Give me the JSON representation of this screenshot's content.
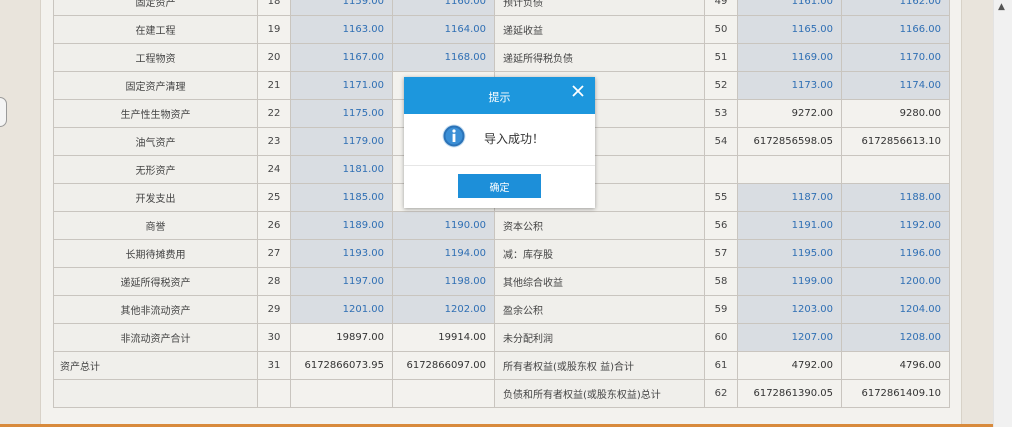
{
  "balance_sheet": {
    "rows": [
      {
        "asset": "固定资产",
        "asset_line": "18",
        "asset_end": "1159.00",
        "asset_begin": "1160.00",
        "liab": "预计负债",
        "liab_line": "49",
        "liab_end": "1161.00",
        "liab_begin": "1162.00"
      },
      {
        "asset": "在建工程",
        "asset_line": "19",
        "asset_end": "1163.00",
        "asset_begin": "1164.00",
        "liab": "递延收益",
        "liab_line": "50",
        "liab_end": "1165.00",
        "liab_begin": "1166.00"
      },
      {
        "asset": "工程物资",
        "asset_line": "20",
        "asset_end": "1167.00",
        "asset_begin": "1168.00",
        "liab": "递延所得税负债",
        "liab_line": "51",
        "liab_end": "1169.00",
        "liab_begin": "1170.00"
      },
      {
        "asset": "固定资产清理",
        "asset_line": "21",
        "asset_end": "1171.00",
        "asset_begin": "",
        "liab": "",
        "liab_line": "52",
        "liab_end": "1173.00",
        "liab_begin": "1174.00"
      },
      {
        "asset": "生产性生物资产",
        "asset_line": "22",
        "asset_end": "1175.00",
        "asset_begin": "",
        "liab": "",
        "liab_line": "53",
        "liab_end": "9272.00",
        "liab_begin": "9280.00"
      },
      {
        "asset": "油气资产",
        "asset_line": "23",
        "asset_end": "1179.00",
        "asset_begin": "",
        "liab": "",
        "liab_line": "54",
        "liab_end": "6172856598.05",
        "liab_begin": "6172856613.10"
      },
      {
        "asset": "无形资产",
        "asset_line": "24",
        "asset_end": "1181.00",
        "asset_begin": "",
        "liab": "东权益）：",
        "liab_line": "",
        "liab_end": "",
        "liab_begin": ""
      },
      {
        "asset": "开发支出",
        "asset_line": "25",
        "asset_end": "1185.00",
        "asset_begin": "",
        "liab": "",
        "liab_line": "55",
        "liab_end": "1187.00",
        "liab_begin": "1188.00"
      },
      {
        "asset": "商誉",
        "asset_line": "26",
        "asset_end": "1189.00",
        "asset_begin": "1190.00",
        "liab": "资本公积",
        "liab_line": "56",
        "liab_end": "1191.00",
        "liab_begin": "1192.00"
      },
      {
        "asset": "长期待摊费用",
        "asset_line": "27",
        "asset_end": "1193.00",
        "asset_begin": "1194.00",
        "liab": "减：库存股",
        "liab_line": "57",
        "liab_end": "1195.00",
        "liab_begin": "1196.00"
      },
      {
        "asset": "递延所得税资产",
        "asset_line": "28",
        "asset_end": "1197.00",
        "asset_begin": "1198.00",
        "liab": "其他综合收益",
        "liab_line": "58",
        "liab_end": "1199.00",
        "liab_begin": "1200.00"
      },
      {
        "asset": "其他非流动资产",
        "asset_line": "29",
        "asset_end": "1201.00",
        "asset_begin": "1202.00",
        "liab": "盈余公积",
        "liab_line": "59",
        "liab_end": "1203.00",
        "liab_begin": "1204.00"
      },
      {
        "asset": "非流动资产合计",
        "asset_line": "30",
        "asset_end": "19897.00",
        "asset_begin": "19914.00",
        "liab": "未分配利润",
        "liab_line": "60",
        "liab_end": "1207.00",
        "liab_begin": "1208.00"
      },
      {
        "asset": "资产总计",
        "asset_line": "31",
        "asset_end": "6172866073.95",
        "asset_begin": "6172866097.00",
        "liab": "所有者权益(或股东权 益)合计",
        "liab_line": "61",
        "liab_end": "4792.00",
        "liab_begin": "4796.00"
      },
      {
        "asset": "",
        "asset_line": "",
        "asset_end": "",
        "asset_begin": "",
        "liab": "负债和所有者权益(或股东权益)总计",
        "liab_line": "62",
        "liab_end": "6172861390.05",
        "liab_begin": "6172861409.10"
      }
    ]
  },
  "dialog": {
    "title": "提示",
    "message": "导入成功！",
    "ok_label": "确定",
    "header_color": "#1d97dd",
    "button_color": "#1d8fd9",
    "icon": "info-icon",
    "close_icon": "close-icon"
  }
}
